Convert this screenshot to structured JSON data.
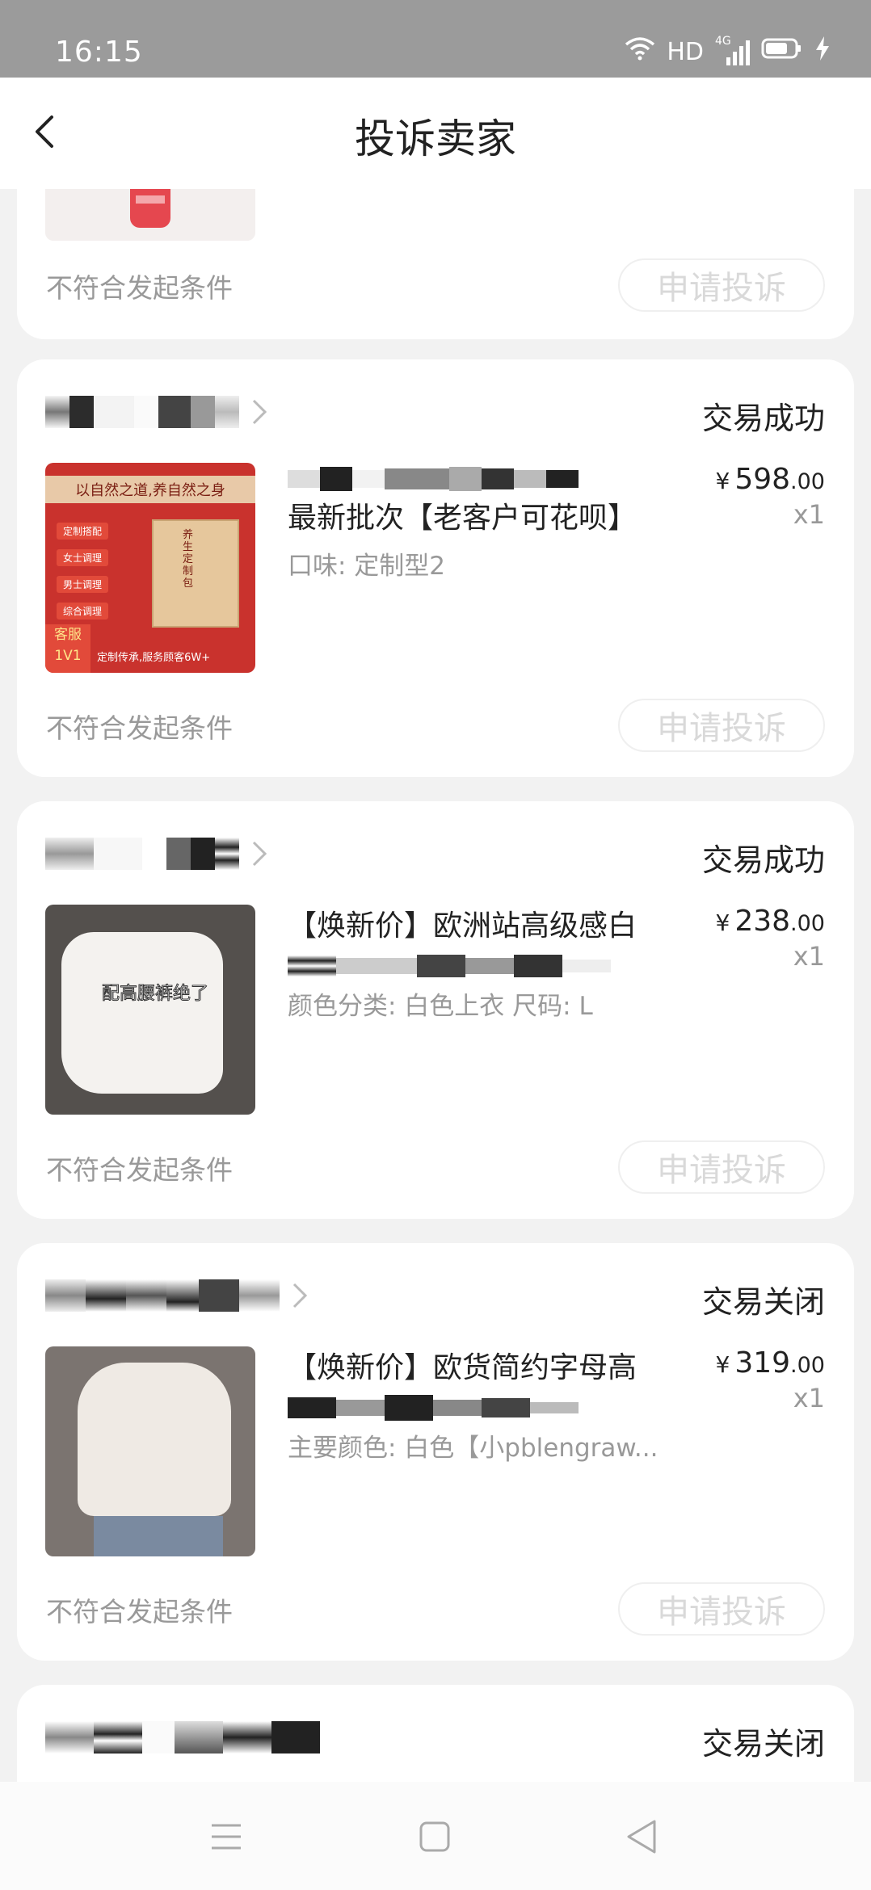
{
  "status_bar": {
    "time": "16:15",
    "network": "HD",
    "signal_label": "4G"
  },
  "header": {
    "title": "投诉卖家"
  },
  "condition_text": "不符合发起条件",
  "complain_label": "申请投诉",
  "orders": [
    {
      "status": "",
      "condition": "不符合发起条件",
      "button": "申请投诉"
    },
    {
      "status": "交易成功",
      "title_line2": "最新批次【老客户可花呗】",
      "sku": "口味: 定制型2",
      "price_symbol": "¥",
      "price_int": "598",
      "price_dec": ".00",
      "qty": "x1",
      "thumb_text": {
        "line1": "以自然之道,养自然之身",
        "tags": [
          "定制搭配",
          "女士调理",
          "男士调理",
          "综合调理"
        ],
        "box": "养生定制包",
        "badge1": "客服",
        "badge2": "1V1",
        "footer": "定制传承,服务顾客6W+"
      }
    },
    {
      "status": "交易成功",
      "title_line1": "【焕新价】欧洲站高级感白",
      "sku": "颜色分类: 白色上衣 尺码: L",
      "price_symbol": "¥",
      "price_int": "238",
      "price_dec": ".00",
      "qty": "x1",
      "thumb_text": {
        "caption": "配高腰裤绝了"
      }
    },
    {
      "status": "交易关闭",
      "title_line1": "【焕新价】欧货简约字母高",
      "sku": "主要颜色: 白色【小pblengraw...",
      "price_symbol": "¥",
      "price_int": "319",
      "price_dec": ".00",
      "qty": "x1"
    },
    {
      "status": "交易关闭"
    }
  ],
  "colors": {
    "status_bar": "#9b9b9b",
    "page_bg": "#f2f2f2",
    "card_bg": "#ffffff",
    "muted_text": "#999999",
    "disabled_button_text": "#d9d9d9"
  },
  "icons": {
    "back": "chevron-left-icon",
    "shop_arrow": "chevron-right-icon",
    "wifi": "wifi-icon",
    "battery": "battery-icon",
    "charging": "lightning-icon",
    "menu": "menu-icon",
    "home": "square-icon",
    "back_nav": "triangle-back-icon"
  }
}
